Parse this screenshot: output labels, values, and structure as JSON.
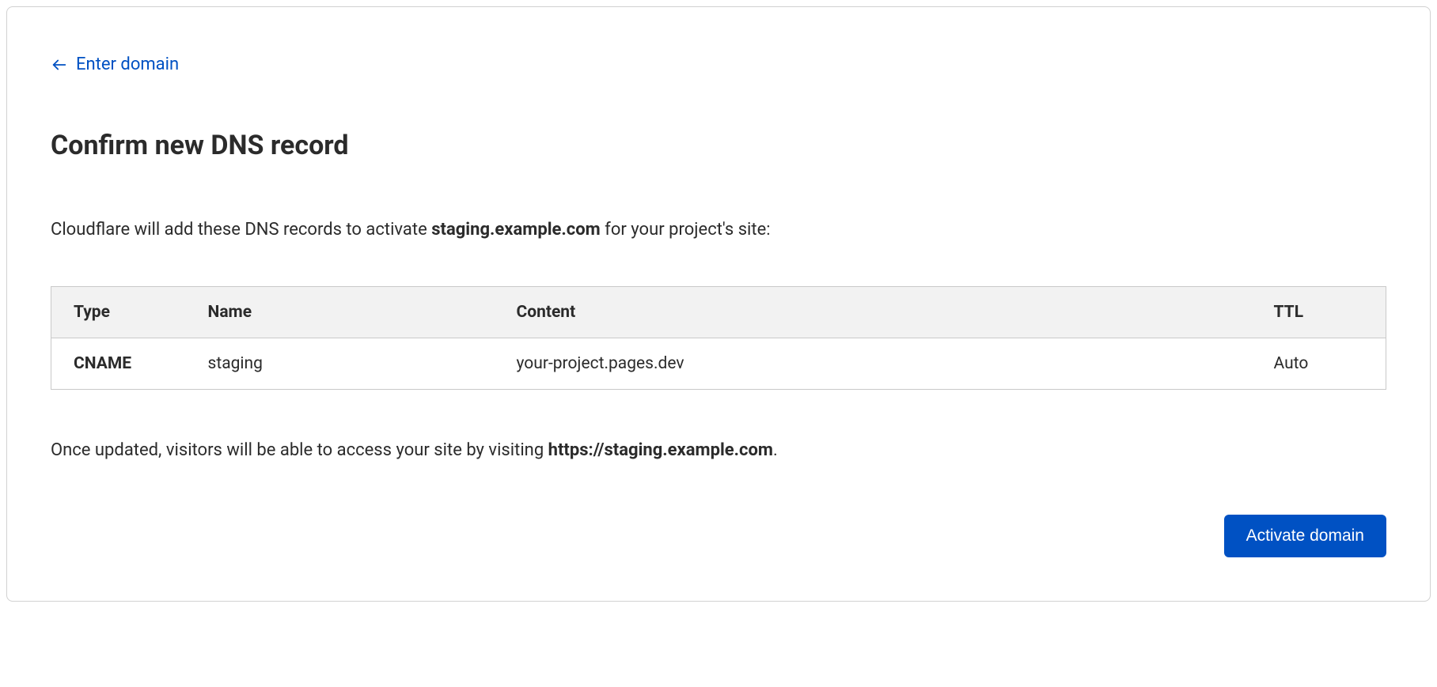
{
  "back_link": {
    "label": "Enter domain"
  },
  "title": "Confirm new DNS record",
  "intro": {
    "prefix": "Cloudflare will add these DNS records to activate ",
    "domain": "staging.example.com",
    "suffix": " for your project's site:"
  },
  "table": {
    "headers": {
      "type": "Type",
      "name": "Name",
      "content": "Content",
      "ttl": "TTL"
    },
    "rows": [
      {
        "type": "CNAME",
        "name": "staging",
        "content": "your-project.pages.dev",
        "ttl": "Auto"
      }
    ]
  },
  "outro": {
    "prefix": "Once updated, visitors will be able to access your site by visiting ",
    "url": "https://staging.example.com",
    "suffix": "."
  },
  "actions": {
    "activate": "Activate domain"
  }
}
